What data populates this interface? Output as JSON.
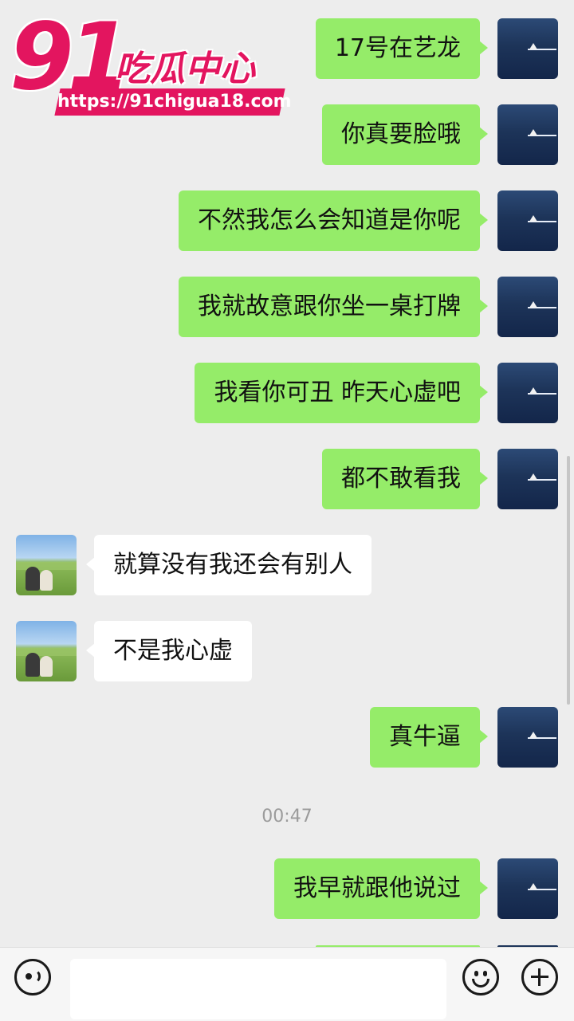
{
  "watermark": {
    "number": "91",
    "title": "吃瓜中心",
    "url": "https://91chigua18.com"
  },
  "messages": [
    {
      "side": "out",
      "text": "17号在艺龙"
    },
    {
      "side": "out",
      "text": "你真要脸哦"
    },
    {
      "side": "out",
      "text": "不然我怎么会知道是你呢"
    },
    {
      "side": "out",
      "text": "我就故意跟你坐一桌打牌"
    },
    {
      "side": "out",
      "text": "我看你可丑 昨天心虚吧"
    },
    {
      "side": "out",
      "text": "都不敢看我"
    },
    {
      "side": "in",
      "text": "就算没有我还会有别人"
    },
    {
      "side": "in",
      "text": "不是我心虚"
    },
    {
      "side": "out",
      "text": "真牛逼"
    },
    {
      "side": "out",
      "text": "我早就跟他说过"
    }
  ],
  "timestamp": "00:47",
  "input_bar": {
    "voice_icon": "voice-icon",
    "emoji_icon": "emoji-icon",
    "plus_icon": "plus-icon",
    "value": ""
  }
}
